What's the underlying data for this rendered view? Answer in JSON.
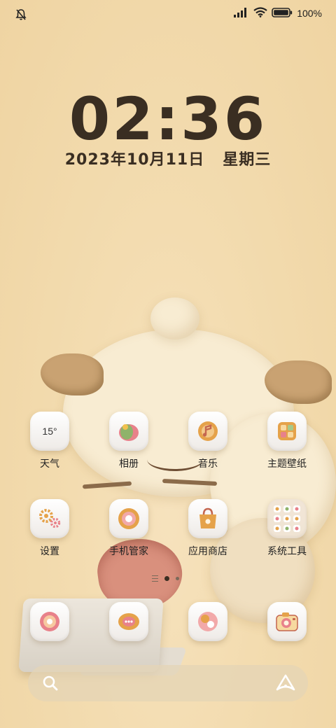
{
  "status_bar": {
    "battery": "100%",
    "icons": [
      "bell-muted-icon",
      "signal-icon",
      "wifi-icon",
      "battery-icon"
    ]
  },
  "clock": {
    "time": "02:36"
  },
  "date": {
    "date": "2023年10月11日",
    "weekday": "星期三"
  },
  "apps": [
    {
      "label": "天气",
      "icon": "weather-icon",
      "temp": "15°"
    },
    {
      "label": "相册",
      "icon": "gallery-icon"
    },
    {
      "label": "音乐",
      "icon": "music-icon"
    },
    {
      "label": "主题壁纸",
      "icon": "themes-icon"
    },
    {
      "label": "设置",
      "icon": "settings-icon"
    },
    {
      "label": "手机管家",
      "icon": "phone-manager-icon"
    },
    {
      "label": "应用商店",
      "icon": "app-store-icon"
    },
    {
      "label": "系统工具",
      "icon": "system-tools-folder-icon"
    }
  ],
  "dock_apps": [
    {
      "icon": "phone-icon"
    },
    {
      "icon": "messages-icon"
    },
    {
      "icon": "browser-icon"
    },
    {
      "icon": "camera-icon"
    }
  ],
  "page_indicator": {
    "pages": 2,
    "current": 1
  },
  "search_bar": {
    "icons": [
      "search-icon",
      "assistant-icon"
    ]
  },
  "colors": {
    "text_dark": "#3a2e22",
    "bg": "#f3dcb0",
    "icon_orange": "#e5a24a",
    "icon_pink": "#e8818a"
  }
}
